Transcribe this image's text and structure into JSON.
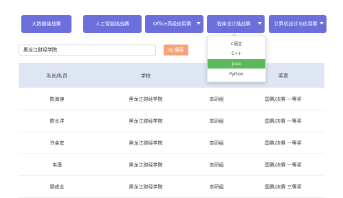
{
  "tabs": [
    {
      "label": "大数据挑战赛",
      "caret": false
    },
    {
      "label": "人工智能挑战赛",
      "caret": false
    },
    {
      "label": "Office高级应用赛",
      "caret": true
    },
    {
      "label": "程序设计挑战赛",
      "caret": true
    },
    {
      "label": "计算机设计与应用赛",
      "caret": true
    }
  ],
  "search": {
    "value": "黑龙江财经学院",
    "button_label": "搜索"
  },
  "dropdown": {
    "options": [
      "C语言",
      "C++",
      "Java",
      "Python"
    ],
    "active_index": 2
  },
  "table": {
    "headers": [
      "队长/队员",
      "学校",
      "组别",
      "奖项"
    ],
    "rows": [
      [
        "陈海庚",
        "黑龙江财经学院",
        "本研组",
        "国赛/决赛 一等奖"
      ],
      [
        "陈长洋",
        "黑龙江财经学院",
        "本研组",
        "国赛/决赛 一等奖"
      ],
      [
        "许金宏",
        "黑龙江财经学院",
        "本研组",
        "国赛/决赛 一等奖"
      ],
      [
        "韦瑾",
        "黑龙江财经学院",
        "本研组",
        "国赛/决赛 一等奖"
      ],
      [
        "顾成业",
        "黑龙江财经学院",
        "本研组",
        "国赛/决赛 三等奖"
      ]
    ]
  },
  "colors": {
    "tab": "#6a6fdc",
    "search_button": "#f4a47b",
    "header_bg": "#dfe6f3",
    "active_option": "#5cb85c"
  }
}
